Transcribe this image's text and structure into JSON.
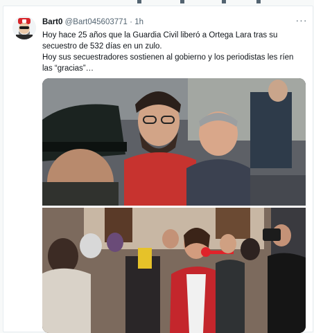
{
  "tweet": {
    "display_name": "Bart0",
    "handle": "@Bart045603771",
    "separator": "·",
    "time": "1h",
    "more_label": "···",
    "text_line1": "Hoy hace 25 años que la Guardia Civil liberó a Ortega Lara tras su secuestro de 532 días en un zulo.",
    "text_line2": "Hoy sus secuestradores sostienen al gobierno y los periodistas les ríen las “gracias”…"
  },
  "media": {
    "photos": [
      {
        "description_icon": "photo-historical-liberation"
      },
      {
        "description_icon": "photo-press-scrum"
      }
    ]
  },
  "colors": {
    "card_bg": "#ffffff",
    "page_bg": "#f7f9f9",
    "text": "#0f1419",
    "muted": "#536471",
    "avatar_accent": "#d7262b"
  }
}
